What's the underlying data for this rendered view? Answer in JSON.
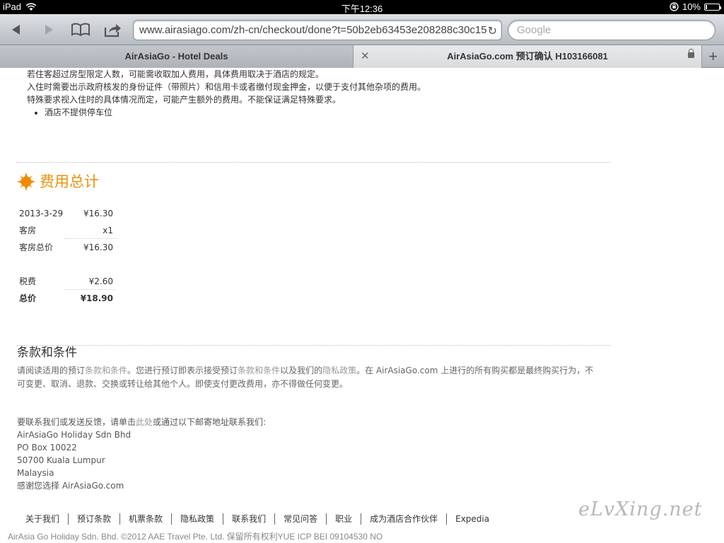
{
  "status_bar": {
    "device": "iPad",
    "time": "下午12:36",
    "battery_percent": "10%",
    "battery_level": 0.1
  },
  "toolbar": {
    "url": "www.airasiago.com/zh-cn/checkout/done?t=50b2eb63453e208288c30c15",
    "search_placeholder": "Google"
  },
  "tabs": [
    {
      "title": "AirAsiaGo - Hotel Deals",
      "active": false
    },
    {
      "title": "AirAsiaGo.com 预订确认 H103166081",
      "active": true
    }
  ],
  "policy": {
    "lines": [
      "若住客超过房型限定人数，可能需收取加人费用，具体费用取决于酒店的规定。",
      "入住时需要出示政府核发的身份证件（带照片）和信用卡或者缴付现金押金，以便于支付其他杂项的费用。",
      "特殊要求视入住时的具体情况而定，可能产生额外的费用。不能保证满足特殊要求。"
    ],
    "bullets": [
      "酒店不提供停车位"
    ]
  },
  "cost": {
    "title": "费用总计",
    "rows": [
      {
        "label": "2013-3-29",
        "value": "¥16.30"
      },
      {
        "label": "客房",
        "value": "x1"
      },
      {
        "label": "客房总价",
        "value": "¥16.30"
      },
      {
        "label": "税费",
        "value": "¥2.60"
      },
      {
        "label": "总价",
        "value": "¥18.90"
      }
    ]
  },
  "terms": {
    "title": "条款和条件",
    "p1": "请阅读适用的预订",
    "link1": "条款和条件",
    "p2": "。您进行预订即表示接受预订",
    "link2": "条款和条件",
    "p3": "以及我们的",
    "link3": "隐私政策",
    "p4": "。在 AirAsiaGo.com 上进行的所有购买都是最终购买行为，不可变更、取消、退款、交换或转让给其他个人。即使支付更改费用，亦不得做任何变更。"
  },
  "contact": {
    "intro_before": "要联系我们或发送反馈，请单击",
    "intro_link": "此处",
    "intro_after": "或通过以下邮寄地址联系我们:",
    "lines": [
      "AirAsiaGo Holiday Sdn Bhd",
      "PO Box 10022",
      "50700 Kuala Lumpur",
      "Malaysia",
      "感谢您选择 AirAsiaGo.com"
    ]
  },
  "footer": {
    "links": [
      "关于我们",
      "预订条款",
      "机票条款",
      "隐私政策",
      "联系我们",
      "常见问答",
      "职业",
      "成为酒店合作伙伴",
      "Expedia"
    ],
    "copyright": "AirAsia Go Holiday Sdn. Bhd. ©2012 AAE Travel Pte. Ltd. 保留所有权利YUE ICP BEI 09104530 NO",
    "watermark": "eLvXing.net"
  }
}
